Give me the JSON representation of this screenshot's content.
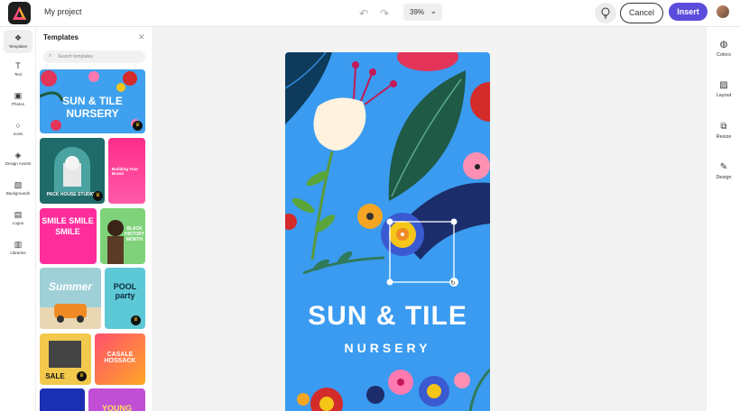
{
  "header": {
    "project_title": "My project",
    "zoom": "39%",
    "cancel_label": "Cancel",
    "insert_label": "Insert"
  },
  "left_rail": [
    {
      "label": "Templates",
      "icon": "templates-icon"
    },
    {
      "label": "Text",
      "icon": "text-icon"
    },
    {
      "label": "Photos",
      "icon": "photos-icon"
    },
    {
      "label": "Icons",
      "icon": "icons-icon"
    },
    {
      "label": "Design Assets",
      "icon": "design-assets-icon"
    },
    {
      "label": "Backgrounds",
      "icon": "backgrounds-icon"
    },
    {
      "label": "Logos",
      "icon": "logos-icon"
    },
    {
      "label": "Libraries",
      "icon": "libraries-icon"
    }
  ],
  "panel": {
    "title": "Templates",
    "search_placeholder": "Search templates",
    "templates": [
      {
        "text": "SUN & TILE\nNURSERY",
        "premium": true
      },
      {
        "text": "PACK HOUSE STUDIOS",
        "premium": true
      },
      {
        "text": "Building Your Brand",
        "premium": false
      },
      {
        "text": "SMILE SMILE SMILE",
        "premium": false
      },
      {
        "text": "BLACK HISTORY MONTH",
        "premium": false
      },
      {
        "text": "Summer",
        "premium": false
      },
      {
        "text": "POOL party",
        "premium": true
      },
      {
        "text": "SALE",
        "premium": true
      },
      {
        "text": "CASALE HOSSACK",
        "premium": false
      },
      {
        "text": "YOUNG",
        "premium": false
      }
    ]
  },
  "canvas": {
    "headline": "SUN & TILE",
    "subline": "NURSERY",
    "background_color": "#3a9bf0"
  },
  "right_rail": [
    {
      "label": "Colors",
      "icon": "palette-icon"
    },
    {
      "label": "Layout",
      "icon": "layout-icon"
    },
    {
      "label": "Resize",
      "icon": "resize-icon"
    },
    {
      "label": "Design",
      "icon": "magic-wand-icon"
    }
  ],
  "colors": {
    "accent": "#5b4cdb",
    "canvas_blue": "#3a9bf0"
  }
}
